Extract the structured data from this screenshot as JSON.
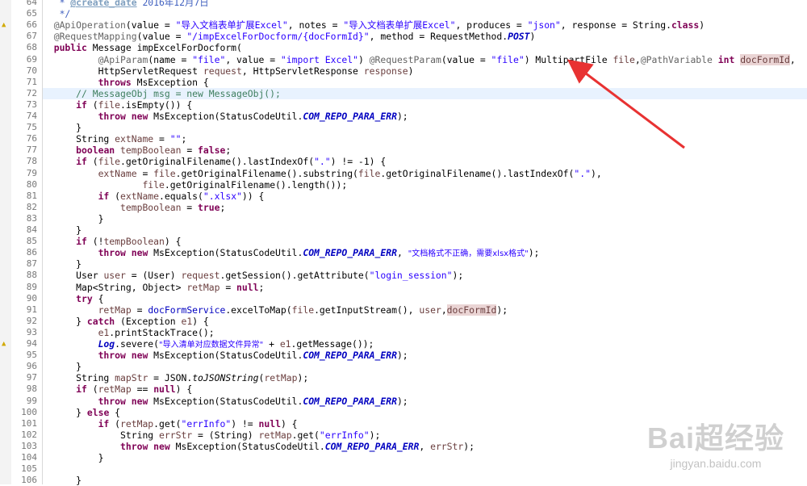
{
  "editor": {
    "lines": [
      {
        "n": "64",
        "marker": "",
        "segs": [
          {
            "t": "   * ",
            "c": "jdoc"
          },
          {
            "t": "@create_date",
            "c": "tag"
          },
          {
            "t": " 2016年12月7日",
            "c": "jdoc"
          }
        ]
      },
      {
        "n": "65",
        "marker": "",
        "segs": [
          {
            "t": "   */",
            "c": "jdoc"
          }
        ]
      },
      {
        "n": "66",
        "marker": "warn",
        "segs": [
          {
            "t": "  @ApiOperation",
            "c": "ann"
          },
          {
            "t": "(value = "
          },
          {
            "t": "\"导入文档表单扩展Excel\"",
            "c": "str"
          },
          {
            "t": ", notes = "
          },
          {
            "t": "\"导入文档表单扩展Excel\"",
            "c": "str"
          },
          {
            "t": ", produces = "
          },
          {
            "t": "\"json\"",
            "c": "str"
          },
          {
            "t": ", response = String."
          },
          {
            "t": "class",
            "c": "kw"
          },
          {
            "t": ")"
          }
        ]
      },
      {
        "n": "67",
        "marker": "",
        "segs": [
          {
            "t": "  @RequestMapping",
            "c": "ann"
          },
          {
            "t": "(value = "
          },
          {
            "t": "\"/impExcelForDocform/{docFormId}\"",
            "c": "str"
          },
          {
            "t": ", method = RequestMethod."
          },
          {
            "t": "POST",
            "c": "sfld"
          },
          {
            "t": ")"
          }
        ]
      },
      {
        "n": "68",
        "marker": "",
        "segs": [
          {
            "t": "  "
          },
          {
            "t": "public",
            "c": "kw"
          },
          {
            "t": " Message impExcelForDocform("
          }
        ]
      },
      {
        "n": "69",
        "marker": "",
        "segs": [
          {
            "t": "          "
          },
          {
            "t": "@ApiParam",
            "c": "ann"
          },
          {
            "t": "(name = "
          },
          {
            "t": "\"file\"",
            "c": "str"
          },
          {
            "t": ", value = "
          },
          {
            "t": "\"import Excel\"",
            "c": "str"
          },
          {
            "t": ") "
          },
          {
            "t": "@RequestParam",
            "c": "ann"
          },
          {
            "t": "(value = "
          },
          {
            "t": "\"file\"",
            "c": "str"
          },
          {
            "t": ") MultipartFile "
          },
          {
            "t": "file",
            "c": "param"
          },
          {
            "t": ","
          },
          {
            "t": "@PathVariable",
            "c": "ann"
          },
          {
            "t": " "
          },
          {
            "t": "int",
            "c": "kw"
          },
          {
            "t": " "
          },
          {
            "t": "docFormId",
            "c": "param hl"
          },
          {
            "t": ","
          }
        ]
      },
      {
        "n": "70",
        "marker": "",
        "segs": [
          {
            "t": "          HttpServletRequest "
          },
          {
            "t": "request",
            "c": "param"
          },
          {
            "t": ", HttpServletResponse "
          },
          {
            "t": "response",
            "c": "param"
          },
          {
            "t": ")"
          }
        ]
      },
      {
        "n": "71",
        "marker": "",
        "segs": [
          {
            "t": "          "
          },
          {
            "t": "throws",
            "c": "kw"
          },
          {
            "t": " MsException {"
          }
        ]
      },
      {
        "n": "72",
        "marker": "",
        "current": true,
        "segs": [
          {
            "t": "      // MessageObj msg = new MessageObj();",
            "c": "cmt"
          }
        ]
      },
      {
        "n": "73",
        "marker": "",
        "segs": [
          {
            "t": "      "
          },
          {
            "t": "if",
            "c": "kw"
          },
          {
            "t": " ("
          },
          {
            "t": "file",
            "c": "param"
          },
          {
            "t": ".isEmpty()) {"
          }
        ]
      },
      {
        "n": "74",
        "marker": "",
        "segs": [
          {
            "t": "          "
          },
          {
            "t": "throw",
            "c": "kw"
          },
          {
            "t": " "
          },
          {
            "t": "new",
            "c": "kw"
          },
          {
            "t": " MsException(StatusCodeUtil."
          },
          {
            "t": "COM_REPO_PARA_ERR",
            "c": "sfld"
          },
          {
            "t": ");"
          }
        ]
      },
      {
        "n": "75",
        "marker": "",
        "segs": [
          {
            "t": "      }"
          }
        ]
      },
      {
        "n": "76",
        "marker": "",
        "segs": [
          {
            "t": "      String "
          },
          {
            "t": "extName",
            "c": "param"
          },
          {
            "t": " = "
          },
          {
            "t": "\"\"",
            "c": "str"
          },
          {
            "t": ";"
          }
        ]
      },
      {
        "n": "77",
        "marker": "",
        "segs": [
          {
            "t": "      "
          },
          {
            "t": "boolean",
            "c": "kw"
          },
          {
            "t": " "
          },
          {
            "t": "tempBoolean",
            "c": "param"
          },
          {
            "t": " = "
          },
          {
            "t": "false",
            "c": "kw"
          },
          {
            "t": ";"
          }
        ]
      },
      {
        "n": "78",
        "marker": "",
        "segs": [
          {
            "t": "      "
          },
          {
            "t": "if",
            "c": "kw"
          },
          {
            "t": " ("
          },
          {
            "t": "file",
            "c": "param"
          },
          {
            "t": ".getOriginalFilename().lastIndexOf("
          },
          {
            "t": "\".\"",
            "c": "str"
          },
          {
            "t": ") != -1) {"
          }
        ]
      },
      {
        "n": "79",
        "marker": "",
        "segs": [
          {
            "t": "          "
          },
          {
            "t": "extName",
            "c": "param"
          },
          {
            "t": " = "
          },
          {
            "t": "file",
            "c": "param"
          },
          {
            "t": ".getOriginalFilename().substring("
          },
          {
            "t": "file",
            "c": "param"
          },
          {
            "t": ".getOriginalFilename().lastIndexOf("
          },
          {
            "t": "\".\"",
            "c": "str"
          },
          {
            "t": "),"
          }
        ]
      },
      {
        "n": "80",
        "marker": "",
        "segs": [
          {
            "t": "                  "
          },
          {
            "t": "file",
            "c": "param"
          },
          {
            "t": ".getOriginalFilename().length());"
          }
        ]
      },
      {
        "n": "81",
        "marker": "",
        "segs": [
          {
            "t": "          "
          },
          {
            "t": "if",
            "c": "kw"
          },
          {
            "t": " ("
          },
          {
            "t": "extName",
            "c": "param"
          },
          {
            "t": ".equals("
          },
          {
            "t": "\".xlsx\"",
            "c": "str"
          },
          {
            "t": ")) {"
          }
        ]
      },
      {
        "n": "82",
        "marker": "",
        "segs": [
          {
            "t": "              "
          },
          {
            "t": "tempBoolean",
            "c": "param"
          },
          {
            "t": " = "
          },
          {
            "t": "true",
            "c": "kw"
          },
          {
            "t": ";"
          }
        ]
      },
      {
        "n": "83",
        "marker": "",
        "segs": [
          {
            "t": "          }"
          }
        ]
      },
      {
        "n": "84",
        "marker": "",
        "segs": [
          {
            "t": "      }"
          }
        ]
      },
      {
        "n": "85",
        "marker": "",
        "segs": [
          {
            "t": "      "
          },
          {
            "t": "if",
            "c": "kw"
          },
          {
            "t": " (!"
          },
          {
            "t": "tempBoolean",
            "c": "param"
          },
          {
            "t": ") {"
          }
        ]
      },
      {
        "n": "86",
        "marker": "",
        "segs": [
          {
            "t": "          "
          },
          {
            "t": "throw",
            "c": "kw"
          },
          {
            "t": " "
          },
          {
            "t": "new",
            "c": "kw"
          },
          {
            "t": " MsException(StatusCodeUtil."
          },
          {
            "t": "COM_REPO_PARA_ERR",
            "c": "sfld"
          },
          {
            "t": ", "
          },
          {
            "t": "\"文档格式不正确，需要xlsx格式\"",
            "c": "str cjk"
          },
          {
            "t": ");"
          }
        ]
      },
      {
        "n": "87",
        "marker": "",
        "segs": [
          {
            "t": "      }"
          }
        ]
      },
      {
        "n": "88",
        "marker": "",
        "segs": [
          {
            "t": "      User "
          },
          {
            "t": "user",
            "c": "param"
          },
          {
            "t": " = (User) "
          },
          {
            "t": "request",
            "c": "param"
          },
          {
            "t": ".getSession().getAttribute("
          },
          {
            "t": "\"login_session\"",
            "c": "str"
          },
          {
            "t": ");"
          }
        ]
      },
      {
        "n": "89",
        "marker": "",
        "segs": [
          {
            "t": "      Map<String, Object> "
          },
          {
            "t": "retMap",
            "c": "param"
          },
          {
            "t": " = "
          },
          {
            "t": "null",
            "c": "kw"
          },
          {
            "t": ";"
          }
        ]
      },
      {
        "n": "90",
        "marker": "",
        "segs": [
          {
            "t": "      "
          },
          {
            "t": "try",
            "c": "kw"
          },
          {
            "t": " {"
          }
        ]
      },
      {
        "n": "91",
        "marker": "",
        "segs": [
          {
            "t": "          "
          },
          {
            "t": "retMap",
            "c": "param"
          },
          {
            "t": " = "
          },
          {
            "t": "docFormService",
            "c": "fld"
          },
          {
            "t": ".excelToMap("
          },
          {
            "t": "file",
            "c": "param"
          },
          {
            "t": ".getInputStream(), "
          },
          {
            "t": "user",
            "c": "param"
          },
          {
            "t": ","
          },
          {
            "t": "docFormId",
            "c": "param hl"
          },
          {
            "t": ");"
          }
        ]
      },
      {
        "n": "92",
        "marker": "",
        "segs": [
          {
            "t": "      } "
          },
          {
            "t": "catch",
            "c": "kw"
          },
          {
            "t": " (Exception "
          },
          {
            "t": "e1",
            "c": "param"
          },
          {
            "t": ") {"
          }
        ]
      },
      {
        "n": "93",
        "marker": "",
        "segs": [
          {
            "t": "          "
          },
          {
            "t": "e1",
            "c": "param"
          },
          {
            "t": ".printStackTrace();"
          }
        ]
      },
      {
        "n": "94",
        "marker": "warn",
        "segs": [
          {
            "t": "          "
          },
          {
            "t": "Log",
            "c": "sfld"
          },
          {
            "t": ".severe("
          },
          {
            "t": "\"导入清单对应数据文件异常\"",
            "c": "str cjk"
          },
          {
            "t": " + "
          },
          {
            "t": "e1",
            "c": "param"
          },
          {
            "t": ".getMessage());"
          }
        ]
      },
      {
        "n": "95",
        "marker": "",
        "segs": [
          {
            "t": "          "
          },
          {
            "t": "throw",
            "c": "kw"
          },
          {
            "t": " "
          },
          {
            "t": "new",
            "c": "kw"
          },
          {
            "t": " MsException(StatusCodeUtil."
          },
          {
            "t": "COM_REPO_PARA_ERR",
            "c": "sfld"
          },
          {
            "t": ");"
          }
        ]
      },
      {
        "n": "96",
        "marker": "",
        "segs": [
          {
            "t": "      }"
          }
        ]
      },
      {
        "n": "97",
        "marker": "",
        "segs": [
          {
            "t": "      String "
          },
          {
            "t": "mapStr",
            "c": "param"
          },
          {
            "t": " = JSON."
          },
          {
            "t": "toJSONString",
            "c": "smeth"
          },
          {
            "t": "("
          },
          {
            "t": "retMap",
            "c": "param"
          },
          {
            "t": ");"
          }
        ]
      },
      {
        "n": "98",
        "marker": "",
        "segs": [
          {
            "t": "      "
          },
          {
            "t": "if",
            "c": "kw"
          },
          {
            "t": " ("
          },
          {
            "t": "retMap",
            "c": "param"
          },
          {
            "t": " == "
          },
          {
            "t": "null",
            "c": "kw"
          },
          {
            "t": ") {"
          }
        ]
      },
      {
        "n": "99",
        "marker": "",
        "segs": [
          {
            "t": "          "
          },
          {
            "t": "throw",
            "c": "kw"
          },
          {
            "t": " "
          },
          {
            "t": "new",
            "c": "kw"
          },
          {
            "t": " MsException(StatusCodeUtil."
          },
          {
            "t": "COM_REPO_PARA_ERR",
            "c": "sfld"
          },
          {
            "t": ");"
          }
        ]
      },
      {
        "n": "100",
        "marker": "",
        "segs": [
          {
            "t": "      } "
          },
          {
            "t": "else",
            "c": "kw"
          },
          {
            "t": " {"
          }
        ]
      },
      {
        "n": "101",
        "marker": "",
        "segs": [
          {
            "t": "          "
          },
          {
            "t": "if",
            "c": "kw"
          },
          {
            "t": " ("
          },
          {
            "t": "retMap",
            "c": "param"
          },
          {
            "t": ".get("
          },
          {
            "t": "\"errInfo\"",
            "c": "str"
          },
          {
            "t": ") != "
          },
          {
            "t": "null",
            "c": "kw"
          },
          {
            "t": ") {"
          }
        ]
      },
      {
        "n": "102",
        "marker": "",
        "segs": [
          {
            "t": "              String "
          },
          {
            "t": "errStr",
            "c": "param"
          },
          {
            "t": " = (String) "
          },
          {
            "t": "retMap",
            "c": "param"
          },
          {
            "t": ".get("
          },
          {
            "t": "\"errInfo\"",
            "c": "str"
          },
          {
            "t": ");"
          }
        ]
      },
      {
        "n": "103",
        "marker": "",
        "segs": [
          {
            "t": "              "
          },
          {
            "t": "throw",
            "c": "kw"
          },
          {
            "t": " "
          },
          {
            "t": "new",
            "c": "kw"
          },
          {
            "t": " MsException(StatusCodeUtil."
          },
          {
            "t": "COM_REPO_PARA_ERR",
            "c": "sfld"
          },
          {
            "t": ", "
          },
          {
            "t": "errStr",
            "c": "param"
          },
          {
            "t": ");"
          }
        ]
      },
      {
        "n": "104",
        "marker": "",
        "segs": [
          {
            "t": "          }"
          }
        ]
      },
      {
        "n": "105",
        "marker": "",
        "segs": [
          {
            "t": ""
          }
        ]
      },
      {
        "n": "106",
        "marker": "",
        "segs": [
          {
            "t": "      }"
          }
        ]
      }
    ]
  },
  "annotation": {
    "color": "#e83232",
    "icon": "arrow-annotation-icon"
  },
  "watermark": {
    "main": "Bai超经验",
    "sub": "jingyan.baidu.com"
  }
}
